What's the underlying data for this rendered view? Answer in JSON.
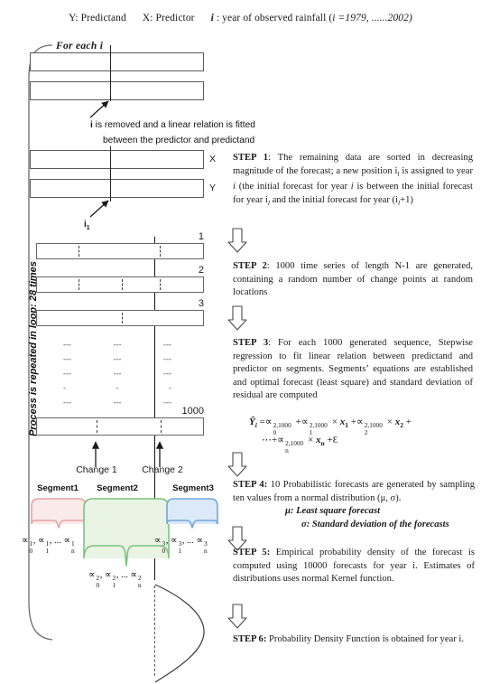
{
  "header": {
    "predictand": "Y: Predictand",
    "predictor": "X: Predictor",
    "index_desc_pre": "i",
    "index_desc": " : year of observed rainfall (",
    "index_range": "i =1979, ......2002)"
  },
  "loop_label": "Process is repeated in loop: 28 times",
  "for_each": "For each   i",
  "first_block": {
    "caption_line1_bold": "i",
    "caption_line1": " is removed and a linear relation is fitted",
    "caption_line2": "between the predictor and predictand"
  },
  "xy_block": {
    "x_label": "X",
    "y_label": "Y",
    "arrow_label": "i",
    "arrow_label_sub": "1"
  },
  "series_rows": {
    "numbers": [
      "1",
      "2",
      "3",
      "1000"
    ],
    "dots": [
      "---",
      "---",
      "---",
      "---",
      "---",
      "---",
      "---",
      "---",
      "---",
      "-",
      "-",
      "-",
      "---",
      "---",
      "---"
    ]
  },
  "changes": {
    "change1": "Change 1",
    "change2": "Change 2"
  },
  "segments": [
    {
      "name": "Segment1",
      "color": "#e8a0a0",
      "fill": "#fbeaea",
      "alpha": "∝01, ∝11, ... ∝n1",
      "sup": "1"
    },
    {
      "name": "Segment2",
      "color": "#7ec27e",
      "fill": "#e9f4e4",
      "alpha": "∝02, ∝12, ... ∝n2",
      "sup": "2"
    },
    {
      "name": "Segment3",
      "color": "#6fa8dc",
      "fill": "#dce9f7",
      "alpha": "∝03, ∝13, ... ∝n3",
      "sup": "3"
    }
  ],
  "steps": {
    "step1": {
      "label": "STEP 1",
      "text": ": The remaining data are sorted in decreasing magnitude of the forecast; a new position i",
      "text_b": " is assigned to year ",
      "text_c": " (the initial forecast for year ",
      "text_d": " is between the initial forecast for year i",
      "text_e": " and the initial forecast for year (i",
      "text_f": "+1)",
      "sub": "l",
      "ital_i": "i"
    },
    "step2": {
      "label": "STEP 2",
      "text": ": 1000 time series of length N-1 are generated, containing a random number of change points at random locations"
    },
    "step3": {
      "label": "STEP 3",
      "text": ": For each 1000 generated sequence, Stepwise regression to fit linear relation between predictand and predictor on segments. Segments’ equations are established and optimal forecast (least square) and standard deviation of residual are computed"
    },
    "equation": {
      "lhs": "Ŷ",
      "lhs_sub": "i",
      "eq": "=",
      "term0_sup": "2,1000",
      "term0_sub": "0",
      "term1_sup": "2,1000",
      "term1_sub": "1",
      "x1": "x",
      "x1_sub": "1",
      "term2_sup": "2,1000",
      "term2_sub": "2",
      "x2": "x",
      "x2_sub": "2",
      "termn_sup": "2,1000",
      "termn_sub": "n",
      "xn": "x",
      "xn_sub": "n",
      "dots": "⋯",
      "plus": "+",
      "times": "×",
      "eps": "Ɛ"
    },
    "step4": {
      "label": "STEP 4:",
      "text": " 10 Probabilistic forecasts are generated by sampling ten values from a normal distribution (μ, σ).",
      "mu_line": "μ: Least square forecast",
      "sigma_line": "σ: Standard deviation of the forecasts"
    },
    "step5": {
      "label": "STEP 5:",
      "text": " Empirical probability density of the forecast is computed using 10000 forecasts for year i. Estimates of distributions uses normal Kernel function."
    },
    "step6": {
      "label": "STEP 6:",
      "text": " Probability Density Function is obtained for year i."
    }
  },
  "colors": {
    "ink": "#1a1a1a",
    "box_stroke": "#5a5a5a",
    "seg1": "#e8a0a0",
    "seg2": "#7ec27e",
    "seg3": "#6fa8dc",
    "arrow_outline": "#555555"
  }
}
